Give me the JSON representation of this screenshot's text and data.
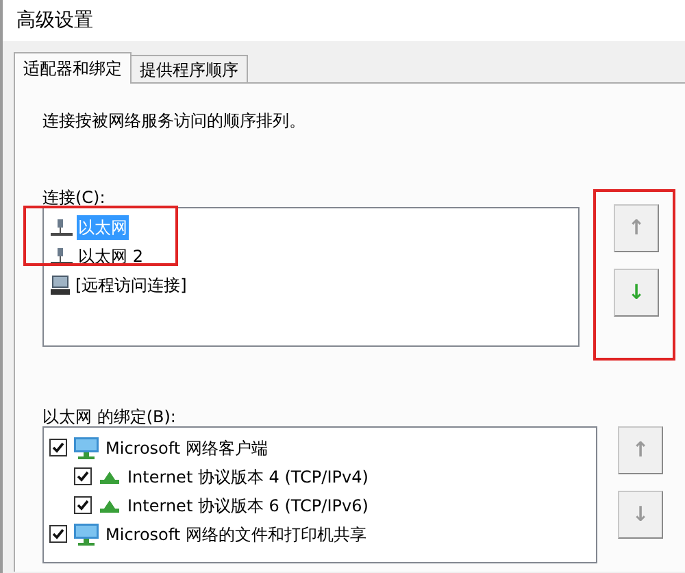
{
  "window": {
    "title": "高级设置"
  },
  "tabs": [
    {
      "label": "适配器和绑定",
      "selected": true
    },
    {
      "label": "提供程序顺序",
      "selected": false
    }
  ],
  "description": "连接按被网络服务访问的顺序排列。",
  "connections": {
    "label": "连接(C):",
    "highlighted": true,
    "items": [
      {
        "kind": "ethernet",
        "label": "以太网",
        "selected": true
      },
      {
        "kind": "ethernet",
        "label": "以太网 2",
        "selected": false
      },
      {
        "kind": "remote",
        "label": "[远程访问连接]",
        "selected": false
      }
    ],
    "buttons": {
      "highlighted": true,
      "up": {
        "label": "↑",
        "disabled": true
      },
      "down": {
        "label": "↓",
        "disabled": false
      }
    }
  },
  "bindings": {
    "label": "以太网 的绑定(B):",
    "items": [
      {
        "kind": "client",
        "label": "Microsoft 网络客户端",
        "checked": true,
        "children": [
          {
            "kind": "protocol",
            "label": "Internet 协议版本 4 (TCP/IPv4)",
            "checked": true
          },
          {
            "kind": "protocol",
            "label": "Internet 协议版本 6 (TCP/IPv6)",
            "checked": true
          }
        ]
      },
      {
        "kind": "client",
        "label": "Microsoft 网络的文件和打印机共享",
        "checked": true
      }
    ],
    "buttons": {
      "up": {
        "label": "↑",
        "disabled": true
      },
      "down": {
        "label": "↓",
        "disabled": true
      }
    }
  }
}
